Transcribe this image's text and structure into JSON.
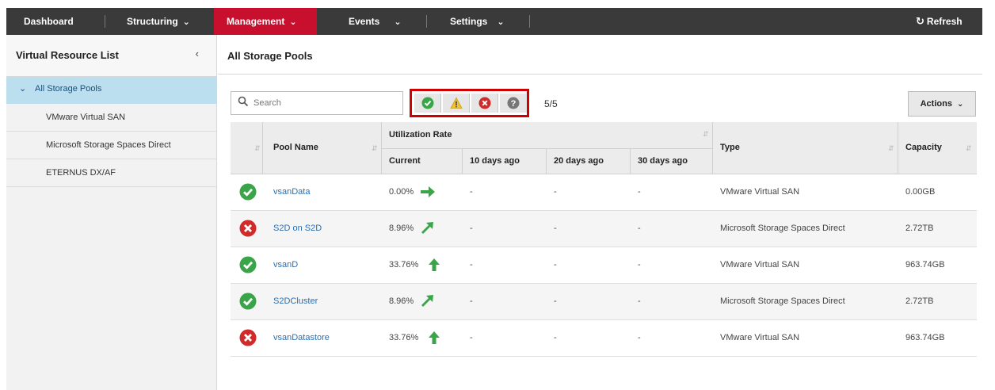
{
  "topnav": {
    "dashboard": "Dashboard",
    "structuring": "Structuring",
    "management": "Management",
    "events": "Events",
    "settings": "Settings",
    "refresh": "Refresh",
    "active_color": "#c8102e"
  },
  "sidebar": {
    "title": "Virtual Resource List",
    "root_label": "All Storage Pools",
    "items": [
      {
        "label": "VMware Virtual SAN"
      },
      {
        "label": "Microsoft Storage Spaces Direct"
      },
      {
        "label": "ETERNUS DX/AF"
      }
    ]
  },
  "main": {
    "title": "All Storage Pools",
    "search_placeholder": "Search",
    "filter_icons": [
      "check-circle-icon",
      "warning-icon",
      "error-icon",
      "unknown-icon"
    ],
    "count": "5/5",
    "actions_label": "Actions"
  },
  "table": {
    "headers": {
      "pool_name": "Pool Name",
      "utilization_rate": "Utilization Rate",
      "current": "Current",
      "d10": "10 days ago",
      "d20": "20 days ago",
      "d30": "30 days ago",
      "type": "Type",
      "capacity": "Capacity"
    },
    "rows": [
      {
        "status": "ok",
        "name": "vsanData",
        "current": "0.00%",
        "trend": "right",
        "d10": "-",
        "d20": "-",
        "d30": "-",
        "type": "VMware Virtual SAN",
        "capacity": "0.00GB"
      },
      {
        "status": "error",
        "name": "S2D on S2D",
        "current": "8.96%",
        "trend": "up-right",
        "d10": "-",
        "d20": "-",
        "d30": "-",
        "type": "Microsoft Storage Spaces Direct",
        "capacity": "2.72TB"
      },
      {
        "status": "ok",
        "name": "vsanD",
        "current": "33.76%",
        "trend": "up",
        "d10": "-",
        "d20": "-",
        "d30": "-",
        "type": "VMware Virtual SAN",
        "capacity": "963.74GB"
      },
      {
        "status": "ok",
        "name": "S2DCluster",
        "current": "8.96%",
        "trend": "up-right",
        "d10": "-",
        "d20": "-",
        "d30": "-",
        "type": "Microsoft Storage Spaces Direct",
        "capacity": "2.72TB"
      },
      {
        "status": "error",
        "name": "vsanDatastore",
        "current": "33.76%",
        "trend": "up",
        "d10": "-",
        "d20": "-",
        "d30": "-",
        "type": "VMware Virtual SAN",
        "capacity": "963.74GB"
      }
    ]
  },
  "colors": {
    "ok": "#3aa548",
    "error": "#d02a2a",
    "trend": "#3aa548",
    "link": "#2a6fb0"
  }
}
